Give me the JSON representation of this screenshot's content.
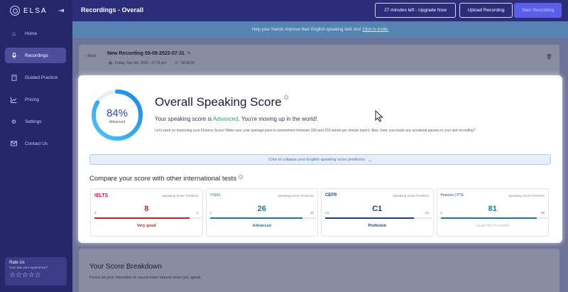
{
  "app": {
    "name": "ELSA"
  },
  "sidebar": {
    "items": [
      {
        "label": "Home",
        "icon": "home-icon"
      },
      {
        "label": "Recordings",
        "icon": "mic-icon",
        "active": true
      },
      {
        "label": "Guided Practice",
        "icon": "book-icon"
      },
      {
        "label": "Pricing",
        "icon": "chart-icon"
      },
      {
        "label": "Settings",
        "icon": "gear-icon"
      },
      {
        "label": "Contact Us",
        "icon": "mail-icon"
      }
    ],
    "rate": {
      "title": "Rate Us",
      "subtitle": "How was your experience?",
      "stars": "☆☆☆☆☆"
    }
  },
  "header": {
    "title": "Recordings - Overall",
    "upgrade_label": "27 minutes left - Upgrade Now",
    "upload_label": "Upload Recording",
    "start_label": "Start Recording"
  },
  "banner": {
    "text": "Help your friends improve their English speaking skill, too!",
    "link": "Click to invite."
  },
  "recording": {
    "back_label": "Back",
    "title": "New Recording 09-09-2022-07-31",
    "date": "Friday, Sep 9th, 2022 - 07:31 pm",
    "duration": "00:00:35"
  },
  "score": {
    "percent": "84%",
    "percent_value": 84,
    "level": "Advanced",
    "title": "Overall Speaking Score",
    "line_prefix": "Your speaking score is ",
    "line_suffix": ". You're moving up in the world!",
    "advice": "Let's work on improving your Fluency Score! Make sure your average pace is somewhere between 100 and 150 words per minute (wpm). Also, have you made any unnatural pauses in your last recording?",
    "collapse_label": "Click to collapse your English speaking score predictors",
    "compare_title": "Compare your score with other international tests"
  },
  "tests": [
    {
      "name": "IELTS",
      "predictor": "Speaking Score Predictor",
      "score": "8",
      "min": "0",
      "max": "9",
      "level": "Very good",
      "fill": 0.89,
      "color": "#b02a2a",
      "logo_color": "#c0272d"
    },
    {
      "name": "TOEFL",
      "predictor": "Speaking Score Predictor",
      "score": "26",
      "min": "0",
      "max": "30",
      "level": "Advanced",
      "fill": 0.87,
      "color": "#1f7a8c",
      "logo_color": "#2c7d4f"
    },
    {
      "name": "CEFR",
      "predictor": "Speaking Score Predictor",
      "score": "C1",
      "min": "A1",
      "max": "C2",
      "level": "Proficient",
      "fill": 0.83,
      "color": "#1f3d7a",
      "logo_color": "#1f3d7a"
    },
    {
      "name": "Pearson | PTE",
      "predictor": "Speaking Score Predictor",
      "score": "81",
      "min": "0",
      "max": "90",
      "level": "Level Not Provided",
      "fill": 0.9,
      "color": "#1f7a8c",
      "logo_color": "#2a4a8a"
    }
  ],
  "breakdown": {
    "title": "Your Score Breakdown",
    "subtitle": "Focus on your intonation to sound more natural when you speak."
  },
  "colors": {
    "sidebar": "#25276b",
    "accent": "#5a5ee8",
    "ring_start": "#4fc3f7",
    "ring_end": "#1e88e5",
    "advanced": "#2aa36a"
  }
}
